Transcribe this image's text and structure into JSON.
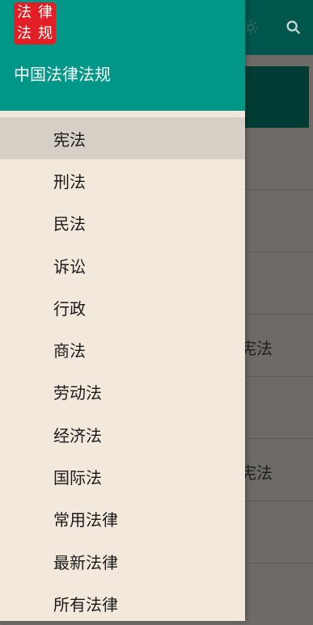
{
  "background": {
    "rows": [
      {
        "text": ""
      },
      {
        "text": ""
      },
      {
        "text": ""
      },
      {
        "text": "宪法"
      },
      {
        "text": ""
      },
      {
        "text": "宪法"
      },
      {
        "text": ""
      },
      {
        "text": ""
      }
    ]
  },
  "drawer": {
    "logo_chars": [
      "法",
      "律",
      "法",
      "规"
    ],
    "app_title": "中国法律法规",
    "items": [
      {
        "label": "宪法"
      },
      {
        "label": "刑法"
      },
      {
        "label": "民法"
      },
      {
        "label": "诉讼"
      },
      {
        "label": "行政"
      },
      {
        "label": "商法"
      },
      {
        "label": "劳动法"
      },
      {
        "label": "经济法"
      },
      {
        "label": "国际法"
      },
      {
        "label": "常用法律"
      },
      {
        "label": "最新法律"
      },
      {
        "label": "所有法律"
      }
    ]
  }
}
